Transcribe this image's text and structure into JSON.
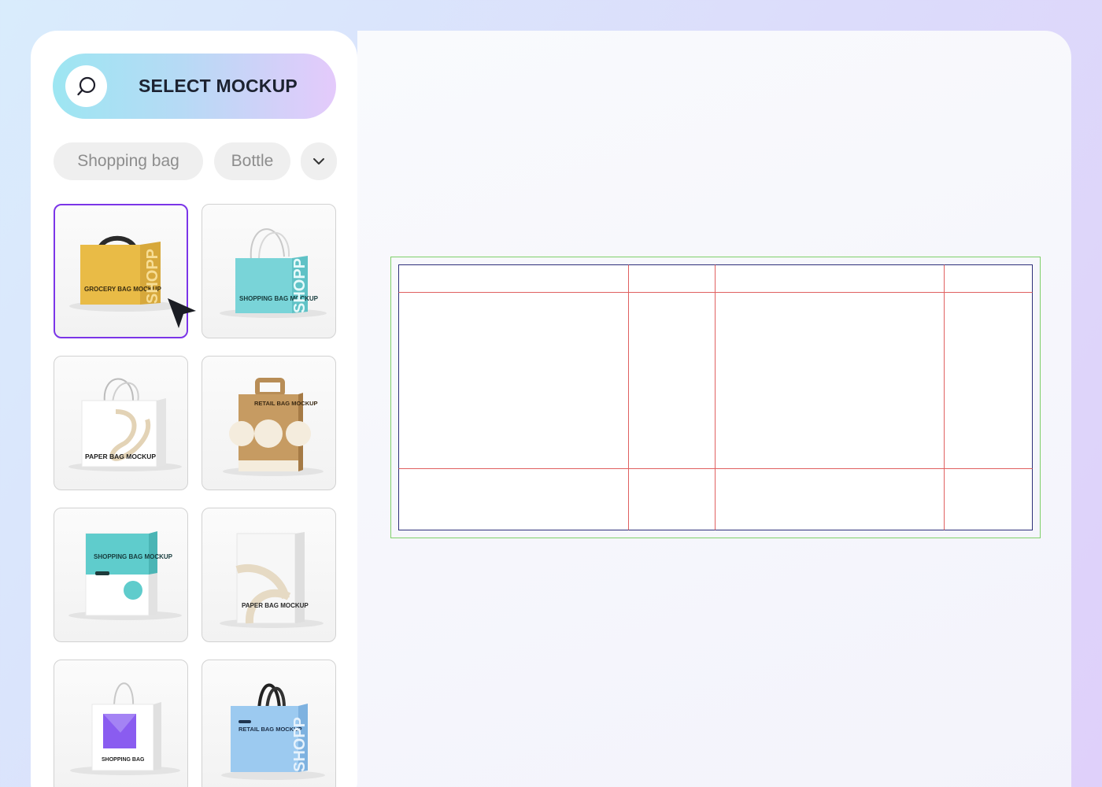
{
  "select_button": {
    "label": "SELECT MOCKUP",
    "icon": "search-icon"
  },
  "filters": {
    "chips": [
      "Shopping bag",
      "Bottle"
    ],
    "more_icon": "chevron-down-icon"
  },
  "mockups": [
    {
      "title": "GROCERY BAG MOCKUP",
      "color": "#e8b94a",
      "selected": true
    },
    {
      "title": "SHOPPING BAG MOCKUP",
      "color": "#79d2d6",
      "selected": false
    },
    {
      "title": "PAPER BAG MOCKUP",
      "color": "#ffffff",
      "selected": false
    },
    {
      "title": "RETAIL BAG MOCKUP",
      "color": "#c49a63",
      "selected": false
    },
    {
      "title": "SHOPPING BAG MOCKUP",
      "color": "#5fcccc",
      "selected": false
    },
    {
      "title": "PAPER BAG MOCKUP",
      "color": "#f4f4f4",
      "selected": false
    },
    {
      "title": "SHOPPING BAG",
      "color": "#ffffff",
      "selected": false
    },
    {
      "title": "RETAIL BAG MOCKUP",
      "color": "#9ccaf0",
      "selected": false
    }
  ],
  "bag_side_text": "SHOPP",
  "colors": {
    "accent": "#7b35e8"
  }
}
